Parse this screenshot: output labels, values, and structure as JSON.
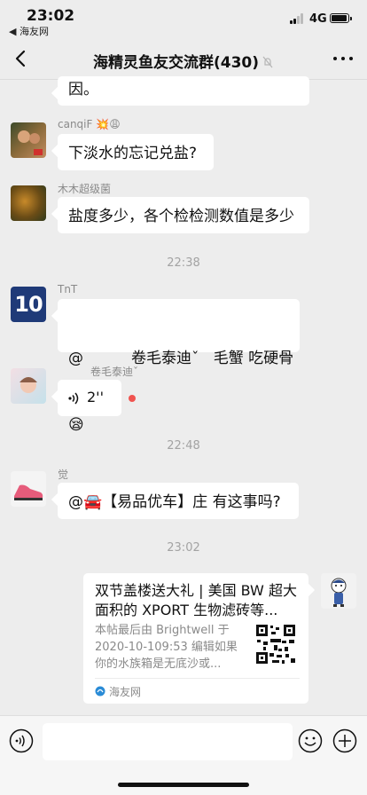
{
  "status": {
    "time": "23:02",
    "back_app": "◀ 海友网",
    "network": "4G"
  },
  "header": {
    "title": "海精灵鱼友交流群(430)"
  },
  "messages": [
    {
      "text": "因。"
    },
    {
      "sender": "canqiF",
      "sender_emoji": "💥😩",
      "text": "下淡水的忘记兑盐?"
    },
    {
      "sender": "木木超级菌",
      "text": "盐度多少，各个检检测数值是多少"
    },
    {
      "timestamp": "22:38"
    },
    {
      "sender": "TnT",
      "avatar_text": "10",
      "text_line1": "@          卷毛泰迪ˇ   毛蟹 吃硬骨",
      "text_line2": "😪"
    },
    {
      "sender": "卷毛泰迪ˇ",
      "voice_duration": "2''"
    },
    {
      "timestamp": "22:48"
    },
    {
      "sender": "觉",
      "text": "@🚘【易品优车】庄 有这事吗?"
    },
    {
      "timestamp": "23:02"
    }
  ],
  "link_card": {
    "title": "双节盖楼送大礼 | 美国 BW 超大面积的 XPORT 生物滤砖等...",
    "desc": "本帖最后由 Brightwell 于 2020-10-109:53 编辑如果你的水族箱是无底沙或...",
    "source": "海友网"
  },
  "colors": {
    "background": "#ededed",
    "bubble": "#ffffff",
    "unread": "#f0534f"
  }
}
